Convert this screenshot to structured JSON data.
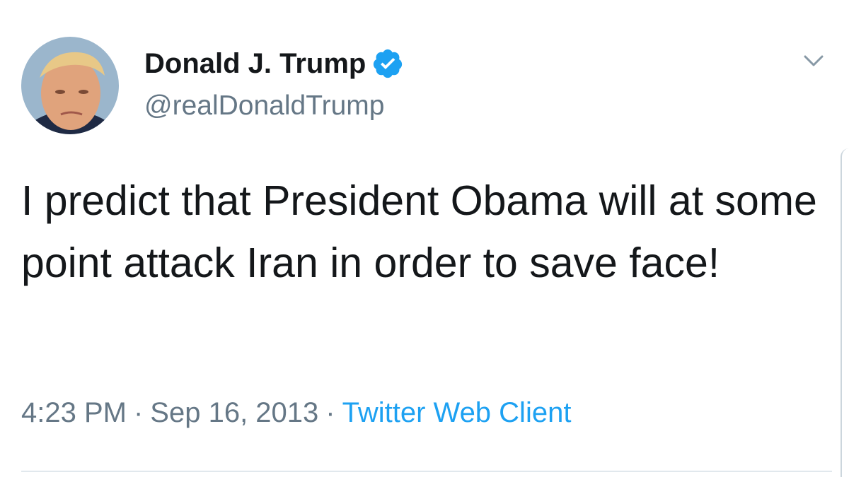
{
  "user": {
    "display_name": "Donald J. Trump",
    "handle": "@realDonaldTrump",
    "verified": true,
    "avatar_icon": "profile-photo"
  },
  "tweet": {
    "text": "I predict that President Obama will at some point attack Iran in order to save face!",
    "time": "4:23 PM",
    "separator": "·",
    "date": "Sep 16, 2013",
    "source": "Twitter Web Client"
  },
  "icons": {
    "verified": "verified-badge-icon",
    "menu": "chevron-down-icon"
  },
  "colors": {
    "text": "#14171a",
    "secondary": "#657786",
    "accent": "#1da1f2",
    "divider": "#e1e8ed"
  }
}
